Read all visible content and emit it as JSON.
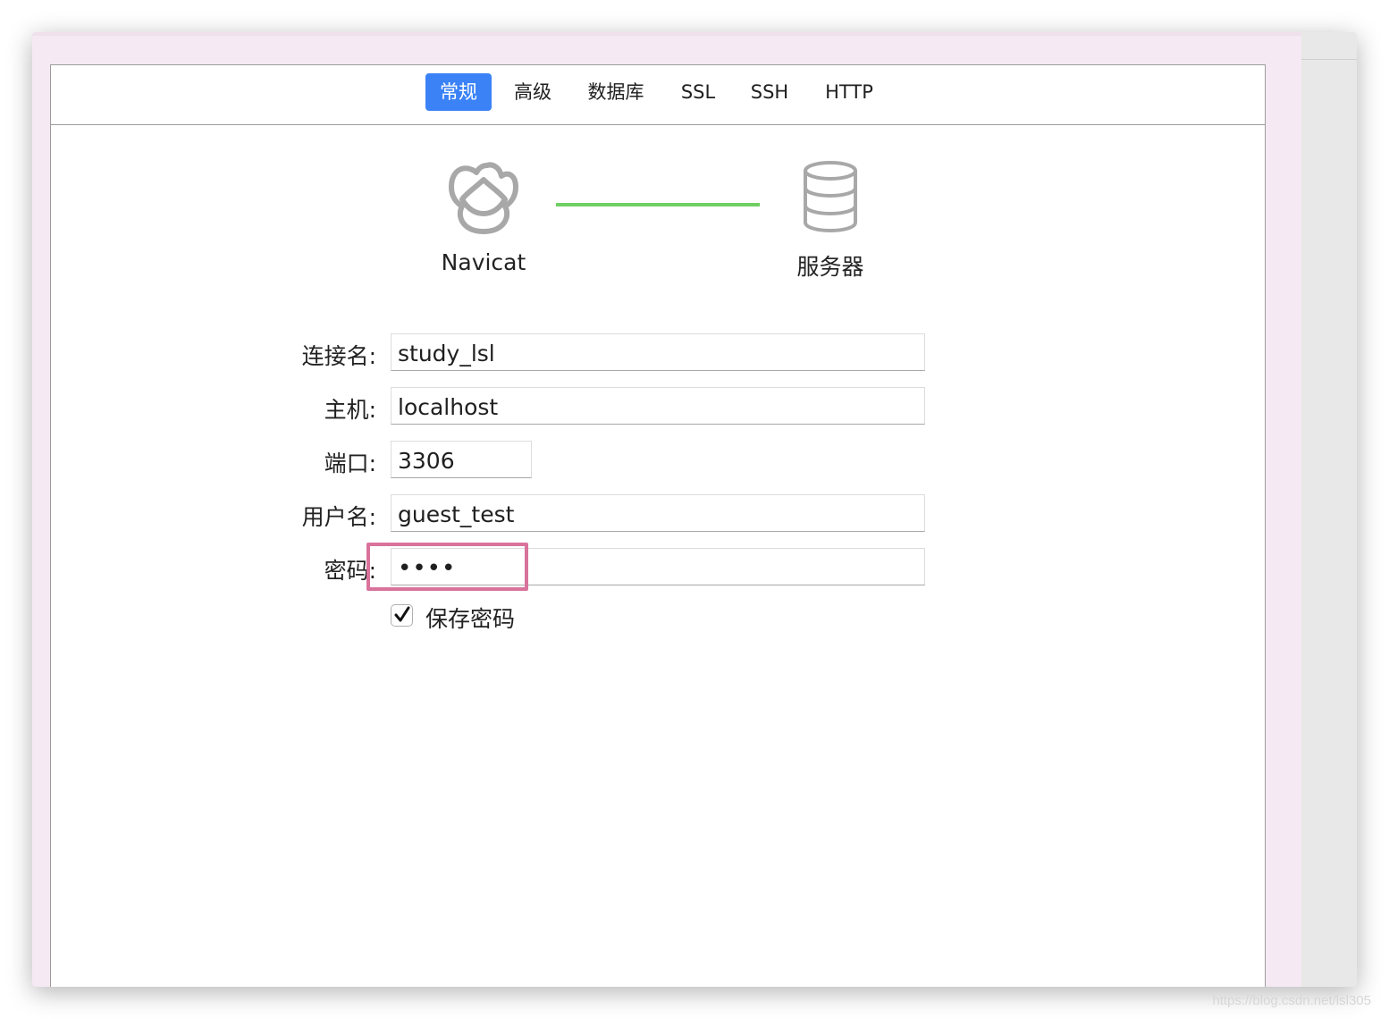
{
  "tabs": [
    "常规",
    "高级",
    "数据库",
    "SSL",
    "SSH",
    "HTTP"
  ],
  "active_tab": "常规",
  "diagram": {
    "client_label": "Navicat",
    "server_label": "服务器",
    "client_icon": "navicat-logo-icon",
    "server_icon": "database-icon",
    "connection_color": "#6fcf62"
  },
  "form": {
    "connection_name": {
      "label": "连接名:",
      "value": "study_lsl"
    },
    "host": {
      "label": "主机:",
      "value": "localhost"
    },
    "port": {
      "label": "端口:",
      "value": "3306"
    },
    "username": {
      "label": "用户名:",
      "value": "guest_test"
    },
    "password": {
      "label": "密码:",
      "value": "••••"
    },
    "save_password": {
      "label": "保存密码",
      "checked": true
    }
  },
  "colors": {
    "accent": "#3b82f6",
    "highlight": "#d9739b",
    "window_bg": "#f5e9f3"
  },
  "watermark": "https://blog.csdn.net/lsl305"
}
